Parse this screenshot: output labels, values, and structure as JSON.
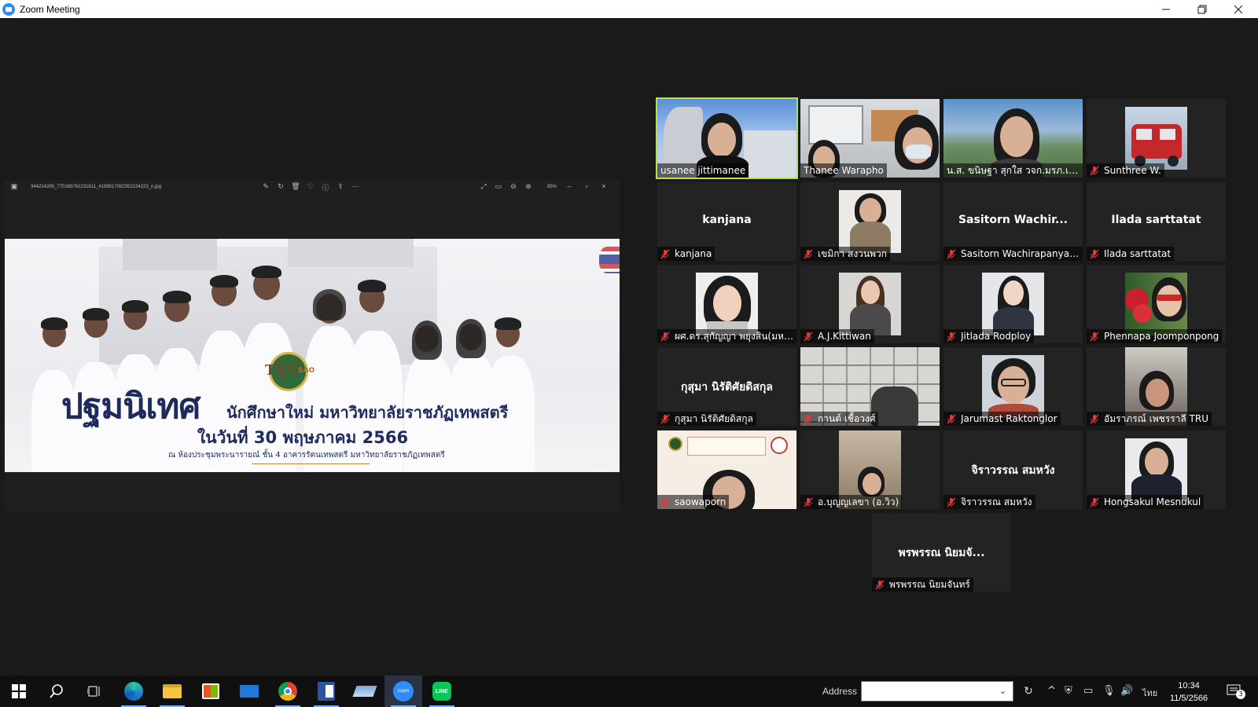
{
  "window": {
    "title": "Zoom Meeting"
  },
  "share": {
    "filename": "344224285_770160761231811_4189517082352134223_n.jpg",
    "zoom": "95%",
    "banner": {
      "title_main": "ปฐมนิเทศ",
      "title_sub": "นักศึกษาใหม่ มหาวิทยาลัยราชภัฏเทพสตรี",
      "date": "ในวันที่ 30 พฤษภาคม 2566",
      "venue": "ณ ห้องประชุมพระนารายณ์ ชั้น 4 อาคารรัตนเทพสตรี มหาวิทยาลัยราชภัฏเทพสตรี"
    }
  },
  "participants": [
    {
      "name": "usanee jittimanee",
      "muted": false,
      "active_speaker": true
    },
    {
      "name": "Thanee Warapho",
      "muted": false
    },
    {
      "name": "น.ส. ขนิษฐา สุกใส วจก.มรภ.เทพ...",
      "muted": false
    },
    {
      "name": "Sunthree W.",
      "muted": true
    },
    {
      "name": "kanjana",
      "display": "kanjana",
      "muted": true
    },
    {
      "name": "เขมิกา สงวนพวก",
      "muted": true
    },
    {
      "name": "Sasitorn Wachirapanyap...",
      "display": "Sasitorn  Wachir...",
      "muted": true
    },
    {
      "name": "Ilada sarttatat",
      "display": "Ilada sarttatat",
      "muted": true
    },
    {
      "name": "ผศ.ดร.สุกัญญา พยุงสิน(มหา...",
      "muted": true
    },
    {
      "name": "A.J.Kittiwan",
      "muted": true
    },
    {
      "name": "Jitlada Rodploy",
      "muted": true
    },
    {
      "name": "Phennapa Joomponpong",
      "muted": true
    },
    {
      "name": "กุสุมา นิรัติศัยดิสกุล",
      "display": "กุสุมา นิรัติศัยดิสกุล",
      "muted": true
    },
    {
      "name": "กานต์ เชื้อวงศ์",
      "muted": true
    },
    {
      "name": "Jarumast Raktonglor",
      "muted": true
    },
    {
      "name": "อัมราภรณ์ เพชรราลี TRU",
      "muted": true
    },
    {
      "name": "saowaporn",
      "muted": true
    },
    {
      "name": "อ.บุญญเลขา (อ.วิว)",
      "muted": true
    },
    {
      "name": "จิราวรรณ สมหวัง",
      "display": "จิราวรรณ สมหวัง",
      "muted": true
    },
    {
      "name": "Hongsakul Mesnukul",
      "muted": true
    },
    {
      "name": "พรพรรณ นิยมจันทร์",
      "display": "พรพรรณ  นิยมจั...",
      "muted": true
    }
  ],
  "taskbar": {
    "address_label": "Address",
    "language": "ไทย",
    "time": "10:34",
    "date": "11/5/2566",
    "notifications": "3"
  },
  "colors": {
    "background": "#1a1a1a",
    "tile": "#232323",
    "active_speaker_border": "#b8e04a",
    "muted_mic": "#e23b3b",
    "zoom_blue": "#2d8cff"
  }
}
